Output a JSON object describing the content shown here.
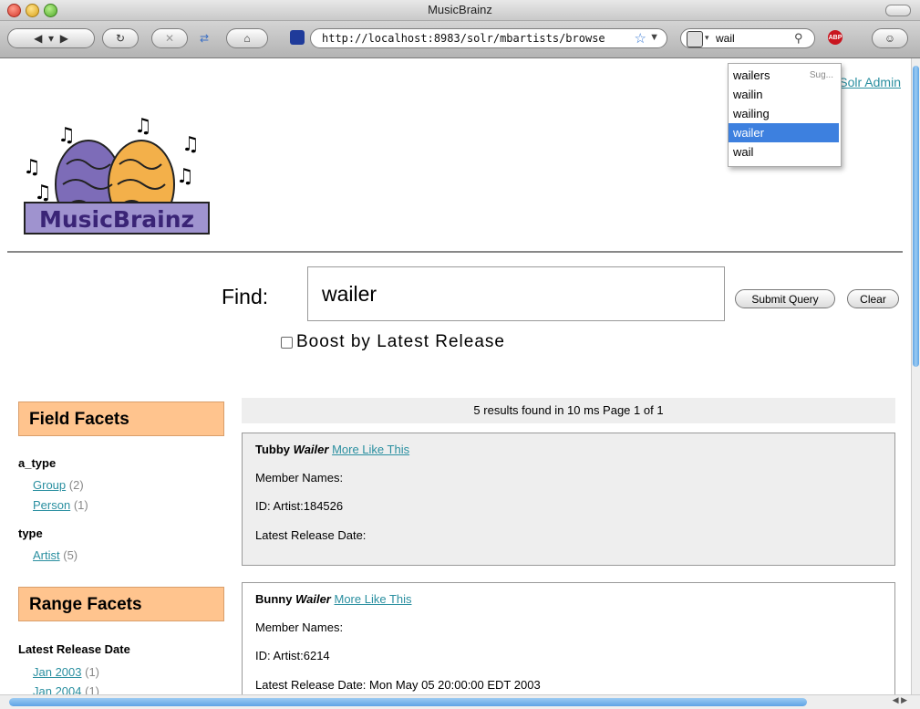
{
  "window": {
    "title": "MusicBrainz"
  },
  "toolbar": {
    "url": "http://localhost:8983/solr/mbartists/browse",
    "search_value": "wail",
    "abp_label": "ABP"
  },
  "autocomplete": {
    "items": [
      "wailers",
      "wailin",
      "wailing",
      "wailer",
      "wail"
    ],
    "hint": "Sug...",
    "selected_index": 3
  },
  "page": {
    "admin_link": "Solr Admin",
    "logo_text": "MusicBrainz",
    "find_label": "Find:",
    "query": "wailer",
    "submit_label": "Submit Query",
    "clear_label": "Clear",
    "boost_label": "Boost by Latest Release"
  },
  "facets": {
    "field_title": "Field Facets",
    "groups": [
      {
        "name": "a_type",
        "items": [
          {
            "label": "Group",
            "count": "(2)"
          },
          {
            "label": "Person",
            "count": "(1)"
          }
        ]
      },
      {
        "name": "type",
        "items": [
          {
            "label": "Artist",
            "count": "(5)"
          }
        ]
      }
    ],
    "range_title": "Range Facets",
    "range_group": "Latest Release Date",
    "range_items": [
      {
        "label": "Jan 2003",
        "count": "(1)"
      },
      {
        "label": "Jan 2004",
        "count": "(1)"
      }
    ]
  },
  "results": {
    "summary": "5 results found in 10 ms Page 1 of 1",
    "more_label": "More Like This",
    "items": [
      {
        "first": "Tubby",
        "last": "Wailer",
        "members": "Member Names:",
        "id": "ID: Artist:184526",
        "date": "Latest Release Date:"
      },
      {
        "first": "Bunny",
        "last": "Wailer",
        "members": "Member Names:",
        "id": "ID: Artist:6214",
        "date": "Latest Release Date: Mon May 05 20:00:00 EDT 2003"
      }
    ]
  },
  "colors": {
    "link": "#2a8fa0",
    "facet_header_bg": "#ffc48e",
    "brain_left": "#7d6cb8",
    "brain_right": "#f3b04a",
    "selection": "#3d80df"
  }
}
